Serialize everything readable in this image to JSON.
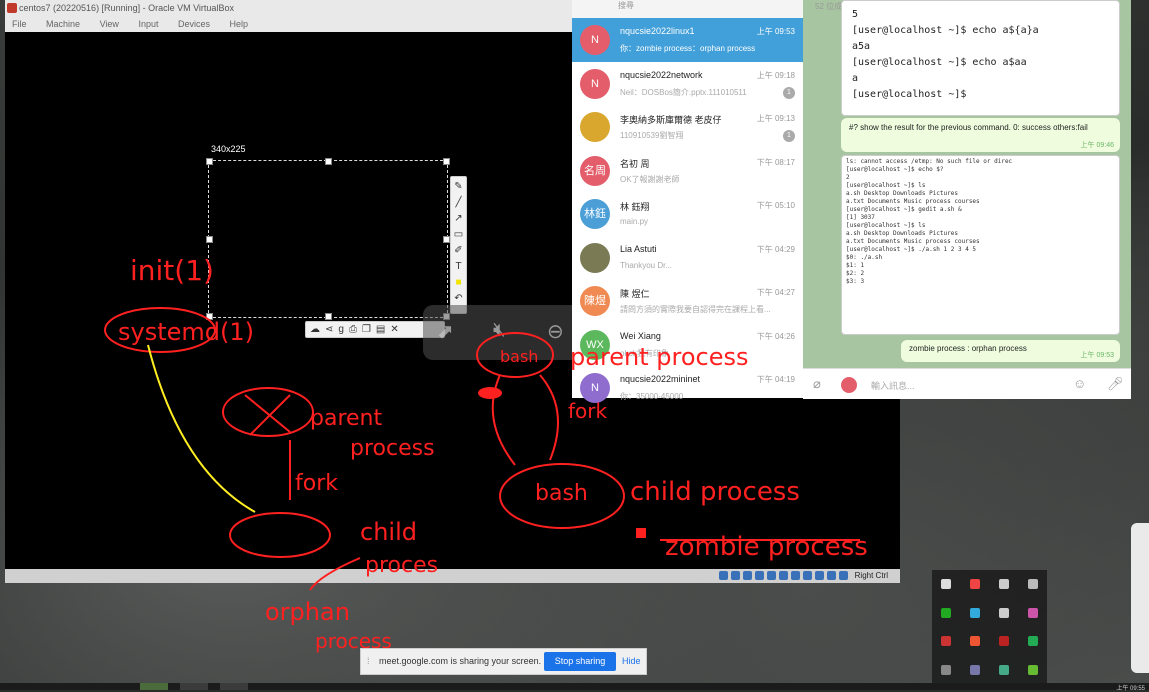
{
  "vbox": {
    "title": "centos7 (20220516) [Running] - Oracle VM VirtualBox",
    "menu": [
      "File",
      "Machine",
      "View",
      "Input",
      "Devices",
      "Help"
    ],
    "right_ctrl": "Right Ctrl"
  },
  "selection": {
    "size_label": "340x225"
  },
  "annotations": {
    "init": "init(1)",
    "systemd": "systemd(1)",
    "parent": "parent",
    "process": "process",
    "fork": "fork",
    "child": "child",
    "child_proces": "proces",
    "orphan": "orphan",
    "orphan_process": "process",
    "bash_top": "bash",
    "parent_process": "parent process",
    "fork_right": "fork",
    "bash_bottom": "bash",
    "child_process": "child process",
    "zombie_process": "zombie process"
  },
  "telegram": {
    "search_placeholder": "搜尋",
    "members": "52 位成員",
    "chats": [
      {
        "name": "nqucsie2022linux1",
        "time": "上午 09:53",
        "msg": "你：zombie process：orphan process",
        "avatar": "N",
        "color": "#e35d6a",
        "group": true
      },
      {
        "name": "nqucsie2022network",
        "time": "上午 09:18",
        "msg": "Neil：DOSBos簡介.pptx.111010511",
        "avatar": "N",
        "color": "#e35d6a",
        "group": true,
        "badge": "1"
      },
      {
        "name": "李奧納多斯庫爾德 老皮仔",
        "time": "上午 09:13",
        "msg": "110910539劉智翔",
        "avatar": "",
        "color": "#d9a62e",
        "badge": "1"
      },
      {
        "name": "名初 周",
        "time": "下午 08:17",
        "msg": "OK了報謝謝老師",
        "avatar": "名周",
        "color": "#e35d6a"
      },
      {
        "name": "林 鈺翔",
        "time": "下午 05:10",
        "msg": "main.py",
        "avatar": "林鈺",
        "color": "#4b9fd6"
      },
      {
        "name": "Lia Astuti",
        "time": "下午 04:29",
        "msg": "Thankyou Dr...",
        "avatar": "",
        "color": "#7a7a55"
      },
      {
        "name": "陳 煜仁",
        "time": "下午 04:27",
        "msg": "請問方須的實際我要自認得完在課程上看...",
        "avatar": "陳煜",
        "color": "#f08a52"
      },
      {
        "name": "Wei Xiang",
        "time": "下午 04:26",
        "msg": "okok我有印象",
        "avatar": "WX",
        "color": "#5cb85c"
      },
      {
        "name": "nqucsie2022mininet",
        "time": "下午 04:19",
        "msg": "你：35000-45000",
        "avatar": "N",
        "color": "#8e6dcf",
        "group": true
      }
    ],
    "terminal_lines": [
      "5",
      "[user@localhost ~]$ echo a${a}a",
      "a5a",
      "[user@localhost ~]$ echo a$aa",
      "a",
      "[user@localhost ~]$ "
    ],
    "bubble1": {
      "text": "#?  show the result for the previous command. 0: success others:fail",
      "time": "上午 09:46"
    },
    "screenshot_lines": [
      "ls: cannot access /etmp: No such file or direc",
      "[user@localhost ~]$ echo $?",
      "2",
      "[user@localhost ~]$ ls",
      "a.sh   Desktop   Downloads  Pictures",
      "a.txt  Documents Music      process  courses",
      "[user@localhost ~]$ gedit a.sh &",
      "[1] 3037",
      "[user@localhost ~]$ ls",
      "a.sh   Desktop   Downloads  Pictures",
      "a.txt  Documents Music      process  courses",
      "[user@localhost ~]$ ./a.sh 1 2 3 4 5",
      "$0: ./a.sh",
      "$1: 1",
      "$2: 2",
      "$3: 3"
    ],
    "bubble2": {
      "text": "zombie process : orphan process",
      "time": "上午 09:53"
    },
    "input_placeholder": "輸入訊息..."
  },
  "meet": {
    "sharing_text": "meet.google.com is sharing your screen.",
    "stop_label": "Stop sharing",
    "hide_label": "Hide"
  },
  "taskbar": {
    "clock": "上午 09:55"
  }
}
